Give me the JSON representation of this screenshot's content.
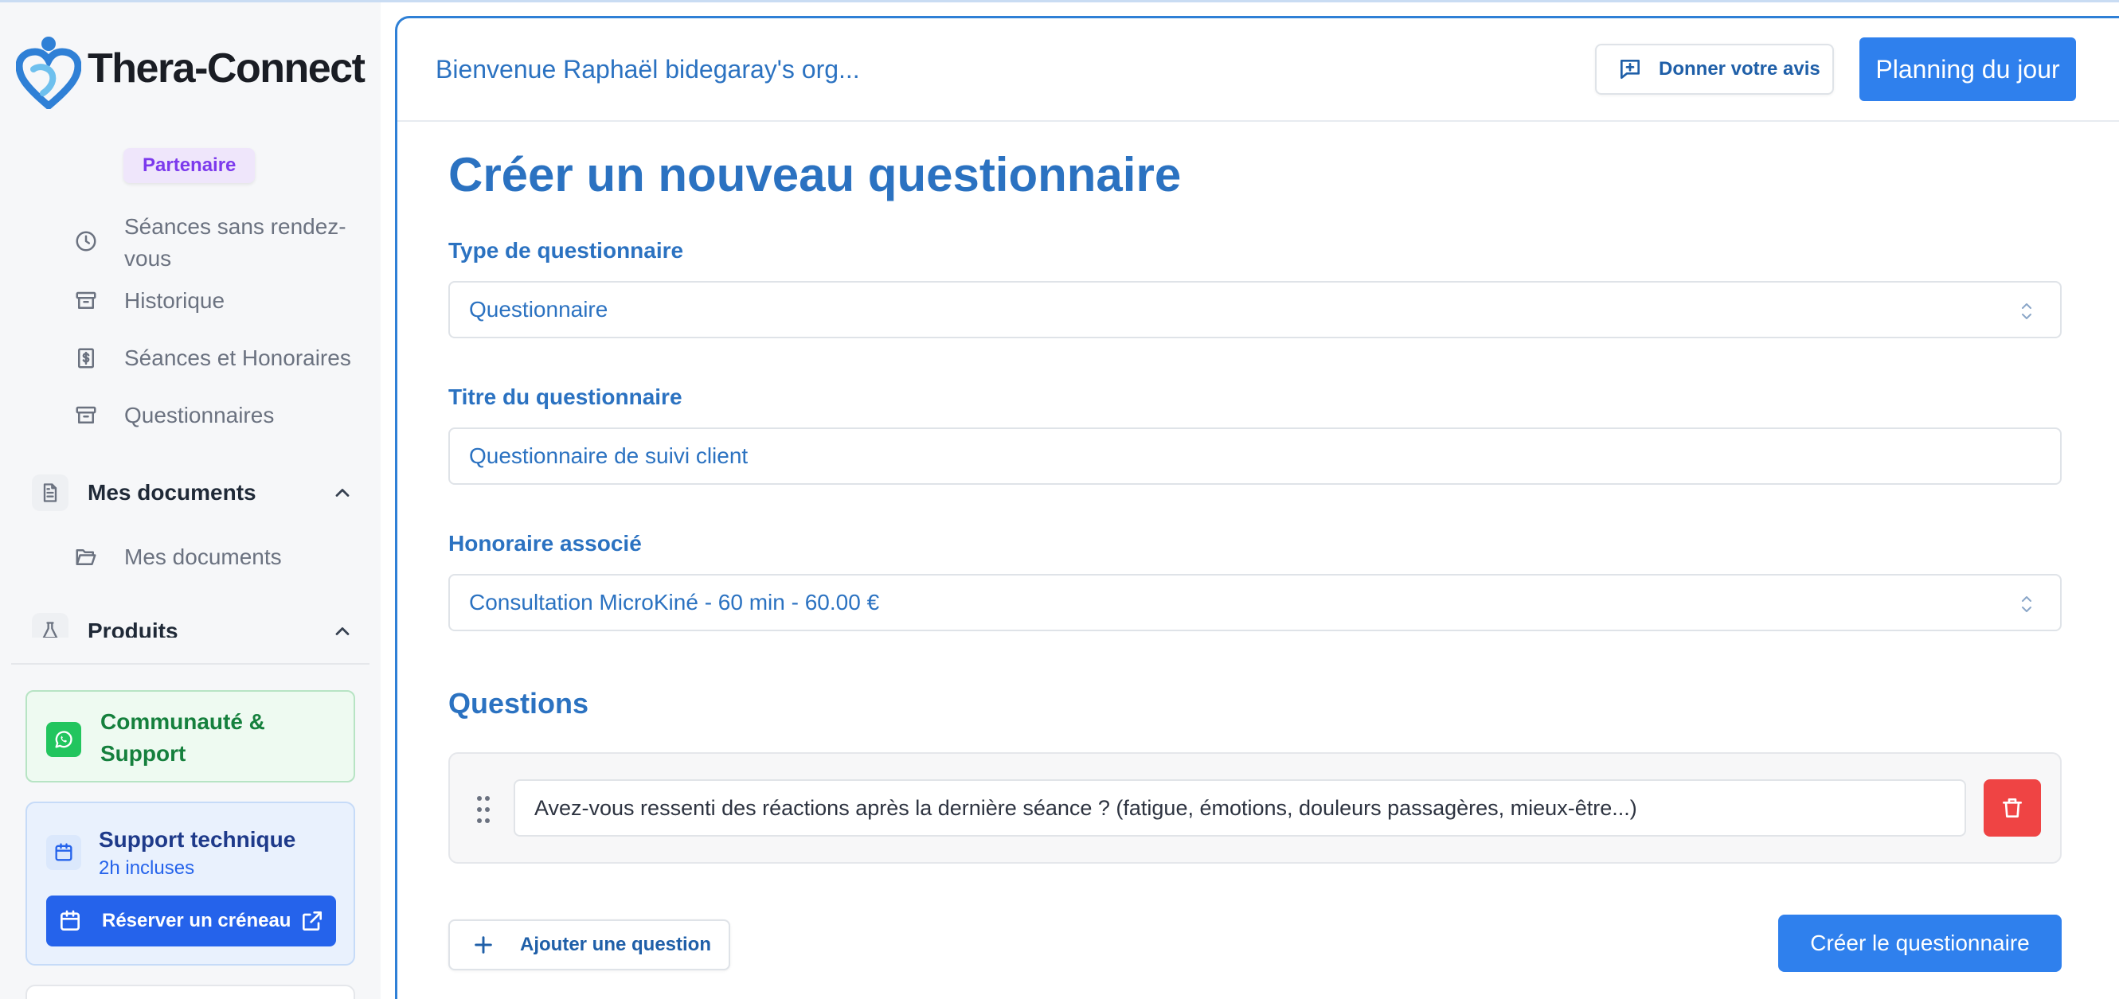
{
  "app": {
    "name": "Thera-Connect",
    "badge": "Partenaire"
  },
  "sidebar": {
    "items": [
      {
        "label": "Séances sans rendez-vous",
        "icon": "clock-icon"
      },
      {
        "label": "Historique",
        "icon": "archive-icon"
      },
      {
        "label": "Séances et Honoraires",
        "icon": "dollar-receipt-icon"
      },
      {
        "label": "Questionnaires",
        "icon": "archive-icon"
      }
    ],
    "sections": [
      {
        "label": "Mes documents",
        "icon": "file-text-icon",
        "expanded": true,
        "items": [
          {
            "label": "Mes documents",
            "icon": "folder-open-icon"
          }
        ]
      },
      {
        "label": "Produits",
        "icon": "flask-icon",
        "expanded": true
      }
    ],
    "community": {
      "label": "Communauté & Support",
      "icon": "whatsapp-icon",
      "color": "#22c55e"
    },
    "support": {
      "title": "Support technique",
      "subtitle": "2h incluses",
      "button_label": "Réserver un créneau",
      "icon": "calendar-icon"
    }
  },
  "header": {
    "welcome": "Bienvenue Raphaël bidegaray's org...",
    "feedback_label": "Donner votre avis",
    "planning_label": "Planning du jour"
  },
  "form": {
    "title": "Créer un nouveau questionnaire",
    "type": {
      "label": "Type de questionnaire",
      "value": "Questionnaire"
    },
    "name": {
      "label": "Titre du questionnaire",
      "value": "Questionnaire de suivi client"
    },
    "fee": {
      "label": "Honoraire associé",
      "value": "Consultation MicroKiné - 60 min - 60.00 €"
    },
    "questions_title": "Questions",
    "questions": [
      "Avez-vous ressenti des réactions après la dernière séance ? (fatigue, émotions, douleurs passagères, mieux-être...)"
    ],
    "add_label": "Ajouter une question",
    "submit_label": "Créer le questionnaire"
  },
  "colors": {
    "accent": "#2f80ed",
    "title": "#2b72c1",
    "danger": "#ef4444",
    "partner": "#7c3aed"
  }
}
